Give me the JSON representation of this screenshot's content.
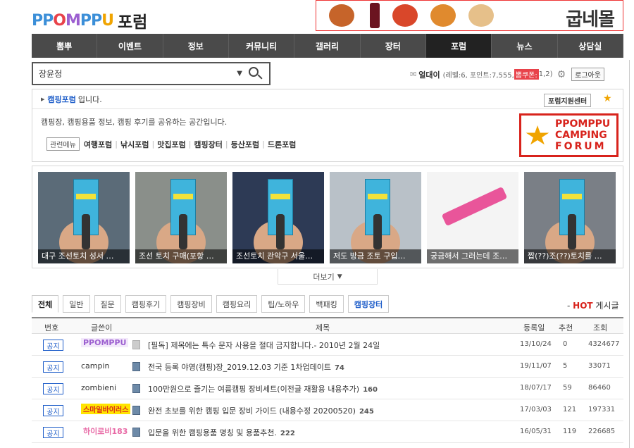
{
  "header": {
    "logo_text": "PPOMPPU",
    "forum_word": "포럼",
    "ad_brand": "굽네몰"
  },
  "nav": [
    {
      "label": "뽐뿌"
    },
    {
      "label": "이벤트"
    },
    {
      "label": "정보"
    },
    {
      "label": "커뮤니티"
    },
    {
      "label": "갤러리"
    },
    {
      "label": "장터"
    },
    {
      "label": "포럼",
      "active": true
    },
    {
      "label": "뉴스"
    },
    {
      "label": "상담실"
    }
  ],
  "search": {
    "value": "장윤정"
  },
  "user": {
    "nickname": "얼대이",
    "stats": "(레벨:6, 포인트:7,555,",
    "coupon": "뽐쿠폰:",
    "coupon_tail": "1,2)",
    "logout_label": "로그아웃"
  },
  "forum": {
    "name": "캠핑포럼",
    "suffix": "입니다.",
    "support_label": "포럼지원센터",
    "description": "캠핑장, 캠핑용품 정보, 캠핑 후기를 공유하는 공간입니다.",
    "related_label": "관련메뉴",
    "related": [
      "여행포럼",
      "낚시포럼",
      "맛집포럼",
      "캠핑장터",
      "등산포럼",
      "드론포럼"
    ],
    "logo_lines": [
      "PPOMPPU",
      "CAMPING",
      "FORUM"
    ]
  },
  "gallery": [
    {
      "caption": "대구 조선토치 성서 …"
    },
    {
      "caption": "조선 토치 구매(포항 …"
    },
    {
      "caption": "조선토치 관악구 서울…"
    },
    {
      "caption": "저도 방금 조토 구입…"
    },
    {
      "caption": "궁금해서 그러는데 조…"
    },
    {
      "caption": "짭(??)조(??)토치를 …"
    }
  ],
  "more_label": "더보기",
  "tabs": [
    {
      "label": "전체",
      "active": true
    },
    {
      "label": "일반"
    },
    {
      "label": "질문"
    },
    {
      "label": "캠핑후기"
    },
    {
      "label": "캠핑장비"
    },
    {
      "label": "캠핑요리"
    },
    {
      "label": "팁/노하우"
    },
    {
      "label": "백패킹"
    },
    {
      "label": "캠핑장터",
      "blue": true
    }
  ],
  "hot": {
    "prefix": "- ",
    "hot": "HOT",
    "suffix": " 게시글"
  },
  "table": {
    "headers": {
      "num": "번호",
      "author": "글쓴이",
      "title": "제목",
      "date": "등록일",
      "rec": "추천",
      "views": "조회"
    },
    "rows": [
      {
        "num": "공지",
        "author": "PPOMPPU",
        "author_style": "logo",
        "title": "[필독] 제목에는 특수 문자 사용을 절대 금지합니다.- 2010년 2월 24일",
        "comments": "",
        "date": "13/10/24",
        "rec": "0",
        "views": "4324677"
      },
      {
        "num": "공지",
        "author": "campin",
        "title": "전국 등록 야영(캠핑)장_2019.12.03 기준 1차업데이트",
        "comments": "74",
        "date": "19/11/07",
        "rec": "5",
        "views": "33071"
      },
      {
        "num": "공지",
        "author": "zombieni",
        "title": "100만원으로 즐기는 여름캠핑 장비세트(이전글 재활용 내용추가)",
        "comments": "160",
        "date": "18/07/17",
        "rec": "59",
        "views": "86460"
      },
      {
        "num": "공지",
        "author": "스마일바이러스",
        "author_style": "yellow",
        "title": "완전 초보를 위한 캠핑 입문 장비 가이드 (내용수정 20200520)",
        "comments": "245",
        "date": "17/03/03",
        "rec": "121",
        "views": "197331"
      },
      {
        "num": "공지",
        "author": "하이로비183",
        "author_style": "pink",
        "title": "입문을 위한 캠핑용품 명칭 및 용품추천.",
        "comments": "222",
        "date": "16/05/31",
        "rec": "119",
        "views": "226685"
      }
    ]
  },
  "colors": {
    "nav_bg": "#4a4a4a",
    "nav_active": "#222222",
    "accent_blue": "#1f5ec9",
    "hot_red": "#d8231c"
  }
}
